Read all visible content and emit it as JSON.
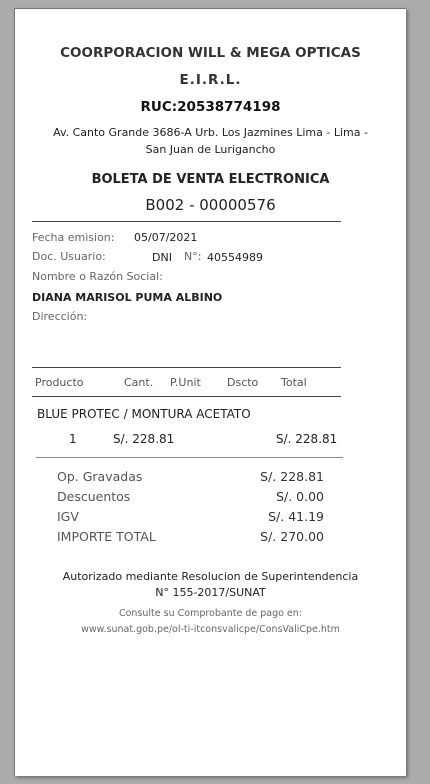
{
  "company": {
    "name_line1": "COORPORACION WILL & MEGA OPTICAS",
    "name_line2": "E.I.R.L.",
    "ruc": "RUC:20538774198",
    "address": "Av. Canto Grande 3686-A Urb. Los Jazmines Lima - Lima - San Juan de Lurigancho"
  },
  "document": {
    "type": "BOLETA DE VENTA ELECTRONICA",
    "number": "B002 - 00000576"
  },
  "customer": {
    "date_label": "Fecha emision:",
    "date_value": "05/07/2021",
    "doc_label": "Doc. Usuario:",
    "doc_type": "DNI",
    "doc_no_label": "N°:",
    "doc_no_value": "40554989",
    "name_label": "Nombre o Razón Social:",
    "name_value": "DIANA MARISOL PUMA ALBINO",
    "address_label": "Dirección:"
  },
  "table": {
    "headers": [
      "Producto",
      "Cant.",
      "P.Unit",
      "Dscto",
      "Total"
    ],
    "items": [
      {
        "description": "BLUE PROTEC / MONTURA ACETATO",
        "qty": "1",
        "unit_price": "S/. 228.81",
        "total": "S/. 228.81"
      }
    ]
  },
  "totals": [
    {
      "label": "Op. Gravadas",
      "value": "S/. 228.81"
    },
    {
      "label": "Descuentos",
      "value": "S/. 0.00"
    },
    {
      "label": "IGV",
      "value": "S/. 41.19"
    },
    {
      "label": "IMPORTE TOTAL",
      "value": "S/. 270.00"
    }
  ],
  "footer": {
    "authorization": "Autorizado mediante Resolucion de Superintendencia N° 155-2017/SUNAT",
    "consult_line1": "Consulte su Comprobante de pago en:",
    "consult_line2": "www.sunat.gob.pe/ol-ti-itconsvalicpe/ConsValiCpe.htm"
  }
}
